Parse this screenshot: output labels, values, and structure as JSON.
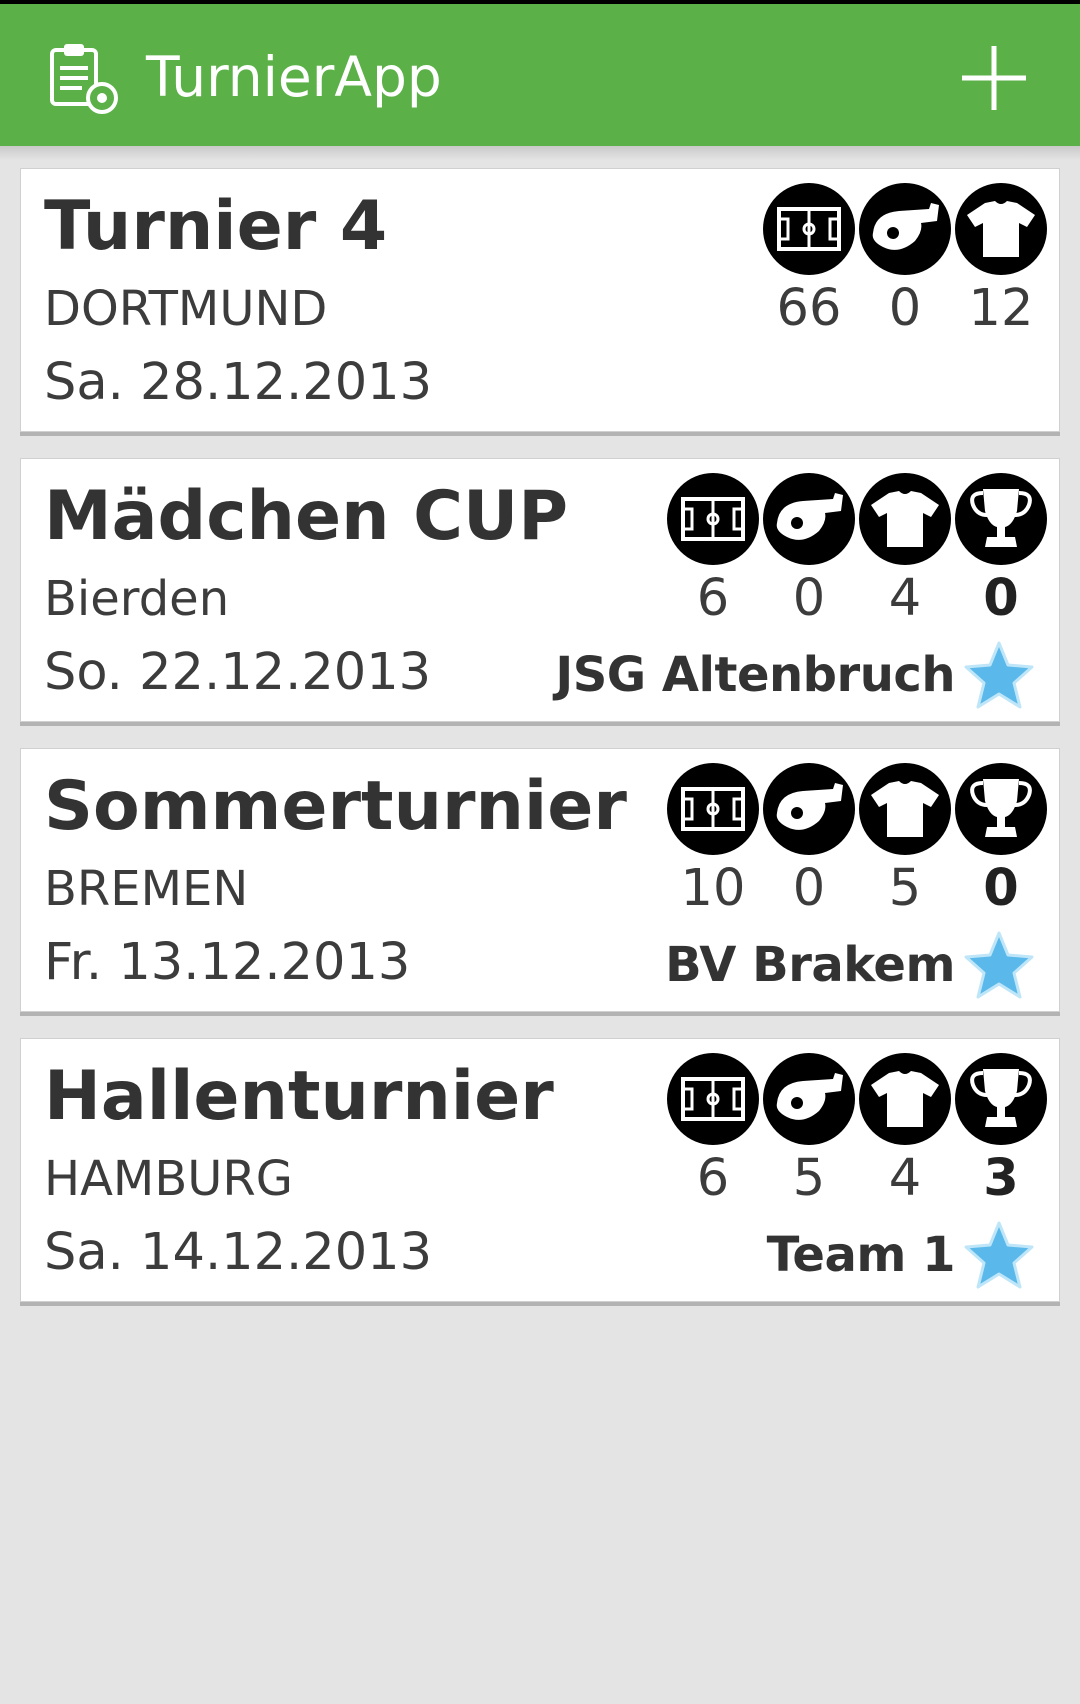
{
  "app": {
    "title": "TurnierApp",
    "add_label": "+"
  },
  "colors": {
    "actionbar": "#5bb047",
    "star": "#5ab9ea"
  },
  "tournaments": [
    {
      "title": "Turnier 4",
      "city": "DORTMUND",
      "date": "Sa. 28.12.2013",
      "stats": {
        "fields": "66",
        "referees": "0",
        "teams": "12"
      }
    },
    {
      "title": "Mädchen CUP",
      "city": "Bierden",
      "date": "So. 22.12.2013",
      "stats": {
        "fields": "6",
        "referees": "0",
        "teams": "4",
        "cup": "0"
      },
      "winner": "JSG Altenbruch"
    },
    {
      "title": "Sommerturnier",
      "city": "BREMEN",
      "date": "Fr. 13.12.2013",
      "stats": {
        "fields": "10",
        "referees": "0",
        "teams": "5",
        "cup": "0"
      },
      "winner": "BV Brakem"
    },
    {
      "title": "Hallenturnier",
      "city": "HAMBURG",
      "date": "Sa. 14.12.2013",
      "stats": {
        "fields": "6",
        "referees": "5",
        "teams": "4",
        "cup": "3"
      },
      "winner": "Team 1"
    }
  ]
}
